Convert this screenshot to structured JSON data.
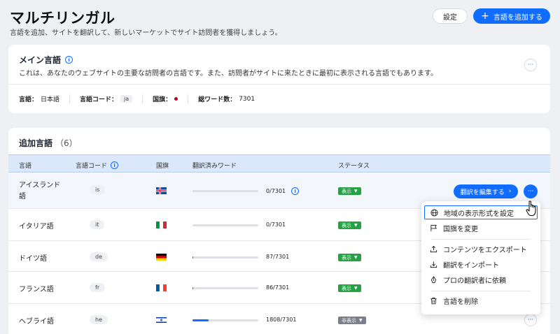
{
  "header": {
    "title": "マルチリンガル",
    "subtitle": "言語を追加、サイトを翻訳して、新しいマーケットでサイト訪問者を獲得しましょう。",
    "settings_label": "設定",
    "add_language_label": "言語を追加する"
  },
  "main_language": {
    "title": "メイン言語",
    "description": "これは、あなたのウェブサイトの主要な訪問者の言語です。また、訪問者がサイトに来たときに最初に表示される言語でもあります。",
    "language_key": "言語：",
    "language_value": "日本語",
    "code_key": "言語コード：",
    "code_value": "ja",
    "flag_key": "国旗：",
    "words_key": "総ワード数：",
    "words_value": "7301"
  },
  "additional": {
    "title": "追加言語",
    "count": "（6）",
    "columns": {
      "language": "言語",
      "code": "言語コード",
      "flag": "国旗",
      "translated": "翻訳済みワード",
      "status": "ステータス"
    },
    "edit_label": "翻訳を編集する",
    "rows": [
      {
        "name": "アイスランド語",
        "code": "is",
        "translated": "0/7301",
        "progress": 0,
        "status": "表示"
      },
      {
        "name": "イタリア語",
        "code": "it",
        "translated": "0/7301",
        "progress": 0,
        "status": "表示"
      },
      {
        "name": "ドイツ語",
        "code": "de",
        "translated": "87/7301",
        "progress": 1.2,
        "status": "表示"
      },
      {
        "name": "フランス語",
        "code": "fr",
        "translated": "86/7301",
        "progress": 1.2,
        "status": "表示"
      },
      {
        "name": "ヘブライ語",
        "code": "he",
        "translated": "1808/7301",
        "progress": 24.8,
        "status": "非表示"
      }
    ]
  },
  "menu": {
    "items": [
      {
        "label": "地域の表示形式を設定",
        "icon": "globe-icon"
      },
      {
        "label": "国旗を変更",
        "icon": "flag-icon"
      },
      {
        "label": "コンテンツをエクスポート",
        "icon": "export-icon"
      },
      {
        "label": "翻訳をインポート",
        "icon": "import-icon"
      },
      {
        "label": "プロの翻訳者に依頼",
        "icon": "pen-icon"
      },
      {
        "label": "言語を削除",
        "icon": "trash-icon"
      }
    ]
  },
  "colors": {
    "accent": "#116dff",
    "status_show": "#25a244",
    "status_hide": "#7a7f8b"
  }
}
